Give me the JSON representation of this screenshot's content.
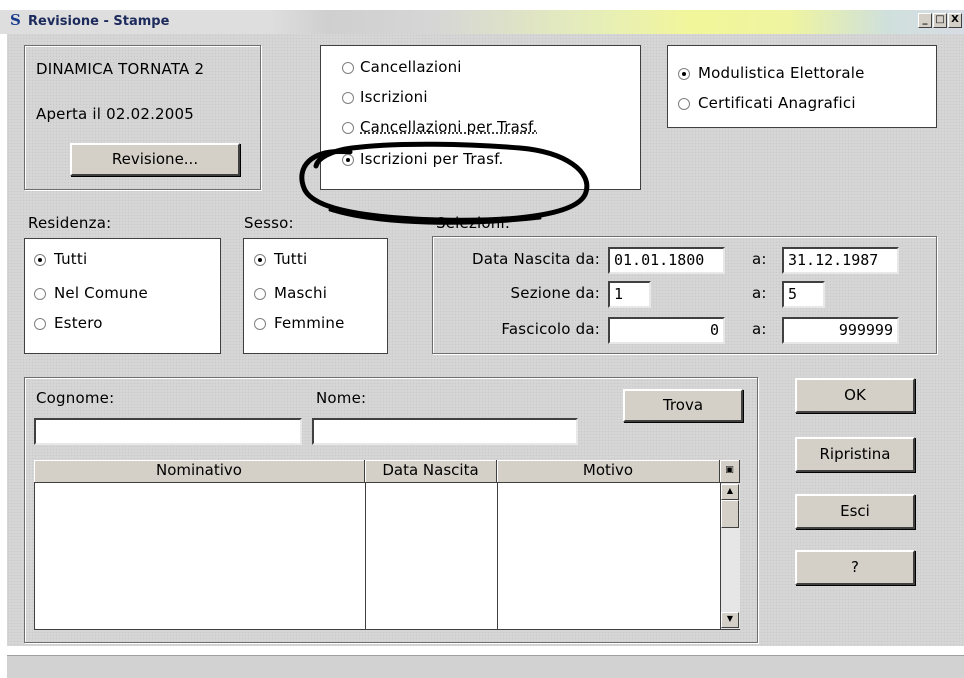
{
  "window": {
    "title": "Revisione - Stampe",
    "buttons": [
      "_",
      "□",
      "X"
    ]
  },
  "dinamica": {
    "title": "DINAMICA TORNATA 2",
    "opened": "Aperta il 02.02.2005",
    "button": "Revisione..."
  },
  "tipo_stampa": [
    {
      "label": "Cancellazioni",
      "checked": false
    },
    {
      "label": "Iscrizioni",
      "checked": false
    },
    {
      "label": "Cancellazioni per Trasf.",
      "checked": false
    },
    {
      "label": "Iscrizioni per Trasf.",
      "checked": true
    }
  ],
  "modulistica": [
    {
      "label": "Modulistica Elettorale",
      "checked": true
    },
    {
      "label": "Certificati Anagrafici",
      "checked": false
    }
  ],
  "residenza": {
    "label": "Residenza:",
    "options": [
      "Tutti",
      "Nel Comune",
      "Estero"
    ],
    "selected": "Tutti"
  },
  "sesso": {
    "label": "Sesso:",
    "options": [
      "Tutti",
      "Maschi",
      "Femmine"
    ],
    "selected": "Tutti"
  },
  "selezioni": {
    "label": "Selezioni:",
    "rows": [
      {
        "label": "Data Nascita da:",
        "from": "01.01.1800",
        "to_label": "a:",
        "to": "31.12.1987"
      },
      {
        "label": "Sezione da:",
        "from": "1",
        "to_label": "a:",
        "to": "5"
      },
      {
        "label": "Fascicolo da:",
        "from": "0",
        "to_label": "a:",
        "to": "999999"
      }
    ]
  },
  "search": {
    "cognome_label": "Cognome:",
    "cognome_value": "",
    "nome_label": "Nome:",
    "nome_value": "",
    "find_button": "Trova"
  },
  "table": {
    "columns": [
      "Nominativo",
      "Data Nascita",
      "Motivo"
    ],
    "rows": []
  },
  "actions": {
    "ok": "OK",
    "reset": "Ripristina",
    "exit": "Esci",
    "help": "?"
  },
  "annotation": {
    "color": "#000000"
  }
}
